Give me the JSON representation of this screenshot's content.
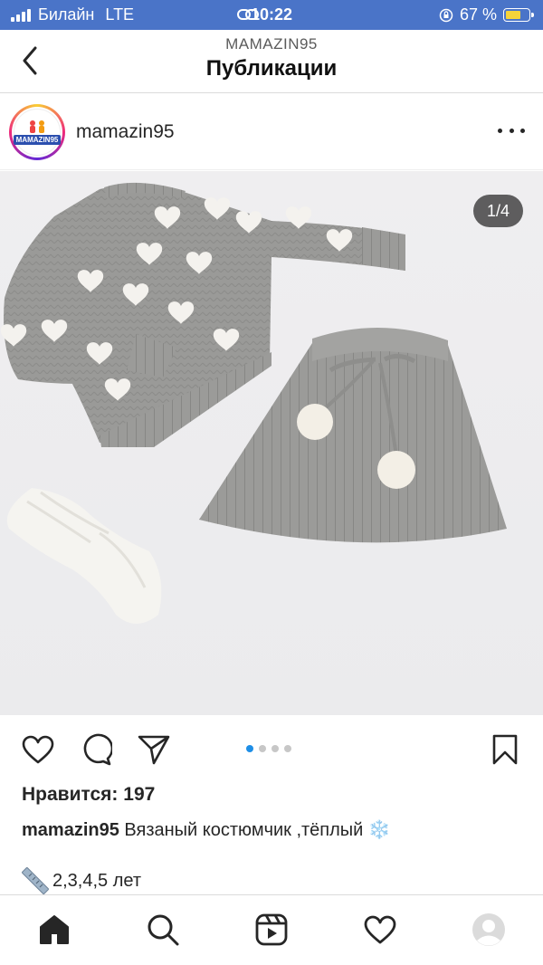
{
  "status_bar": {
    "carrier": "Билайн",
    "network": "LTE",
    "time": "10:22",
    "battery": "67 %",
    "battery_level": 0.67
  },
  "header": {
    "subtitle": "MAMAZIN95",
    "title": "Публикации",
    "back_icon": "chevron-left-icon"
  },
  "post": {
    "username": "mamazin95",
    "avatar_logo_text": "MAMAZIN95",
    "more_icon": "more-horizontal-icon",
    "counter": "1/4",
    "current_slide": 1,
    "total_slides": 4,
    "likes": "Нравится: 197",
    "caption_user": "mamazin95",
    "caption_text": " Вязаный костюмчик ,тёплый ❄️",
    "sizes_text": "2,3,4,5 лет"
  },
  "colors": {
    "status_bar_bg": "#4a74c8",
    "dot_active": "#1e8ee6",
    "knit_gray": "#9a9a98"
  },
  "icons": {
    "actions": [
      "heart-icon",
      "comment-icon",
      "share-icon",
      "bookmark-icon"
    ],
    "nav": [
      "home-icon",
      "search-icon",
      "reels-icon",
      "activity-heart-icon",
      "profile-icon"
    ]
  }
}
